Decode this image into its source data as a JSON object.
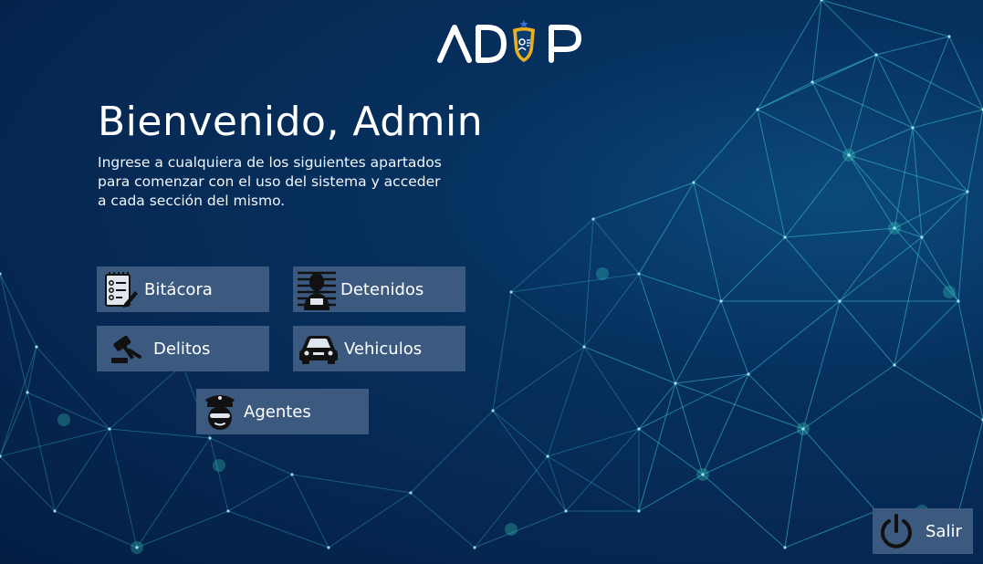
{
  "brand": {
    "logo_text": "ADUP",
    "accent": "#e8b020"
  },
  "welcome": {
    "title": "Bienvenido, Admin",
    "description": "Ingrese a cualquiera de los siguientes apartados para comenzar con el uso del sistema y acceder a cada sección del mismo."
  },
  "menu": {
    "bitacora": {
      "label": "Bitácora",
      "icon": "clipboard-icon"
    },
    "detenidos": {
      "label": "Detenidos",
      "icon": "detainee-icon"
    },
    "delitos": {
      "label": "Delitos",
      "icon": "gavel-icon"
    },
    "vehiculos": {
      "label": "Vehiculos",
      "icon": "car-icon"
    },
    "agentes": {
      "label": "Agentes",
      "icon": "police-officer-icon"
    }
  },
  "exit": {
    "label": "Salir",
    "icon": "power-icon"
  },
  "colors": {
    "background": "#062a55",
    "button": "#3c5a80",
    "text": "#ffffff"
  }
}
